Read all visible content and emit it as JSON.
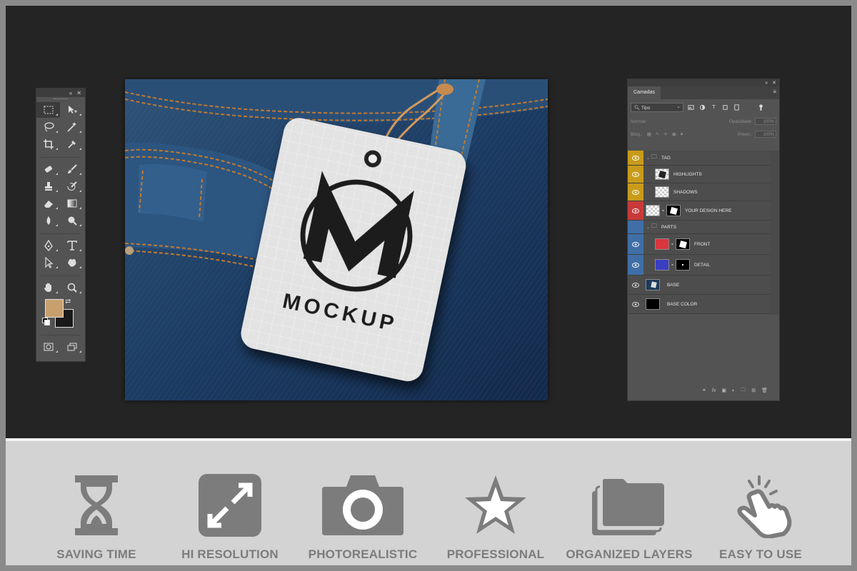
{
  "layers_panel": {
    "tab_label": "Camadas",
    "filter_kind": "Tipo",
    "blend_mode": "Normal",
    "opacity_label": "Opacidade:",
    "opacity_value": "100%",
    "lock_label": "Bloq.:",
    "fill_label": "Preen.:",
    "fill_value": "100%",
    "layers": [
      {
        "name": "TAG",
        "type": "group",
        "color": "#c89b1a"
      },
      {
        "name": "HIGHLIGHTS",
        "type": "layer",
        "color": "#c89b1a"
      },
      {
        "name": "SHADOWS",
        "type": "layer",
        "color": "#c89b1a"
      },
      {
        "name": "YOUR DESIGN HERE",
        "type": "smart",
        "color": "#c83a3a"
      },
      {
        "name": "PARTS",
        "type": "group",
        "color": "#3f6fa6"
      },
      {
        "name": "FRONT",
        "type": "fill",
        "color": "#3f6fa6",
        "swatch": "#d9363e"
      },
      {
        "name": "DETAIL",
        "type": "fill",
        "color": "#3f6fa6",
        "swatch": "#3a3fc4"
      },
      {
        "name": "BASE",
        "type": "image",
        "color": "#535353"
      },
      {
        "name": "BASE COLOR",
        "type": "solid",
        "color": "#535353"
      }
    ]
  },
  "canvas": {
    "tag_brand": "MOCKUP",
    "tag_letter": "M"
  },
  "tools_panel": {
    "foreground_color": "#c8a06e",
    "background_color": "#1a1a1a"
  },
  "features": [
    {
      "label": "SAVING TIME",
      "icon": "hourglass-icon"
    },
    {
      "label": "HI RESOLUTION",
      "icon": "expand-icon"
    },
    {
      "label": "PHOTOREALISTIC",
      "icon": "camera-icon"
    },
    {
      "label": "PROFESSIONAL",
      "icon": "star-icon"
    },
    {
      "label": "ORGANIZED LAYERS",
      "icon": "layers-icon"
    },
    {
      "label": "EASY TO USE",
      "icon": "tap-hand-icon"
    }
  ]
}
